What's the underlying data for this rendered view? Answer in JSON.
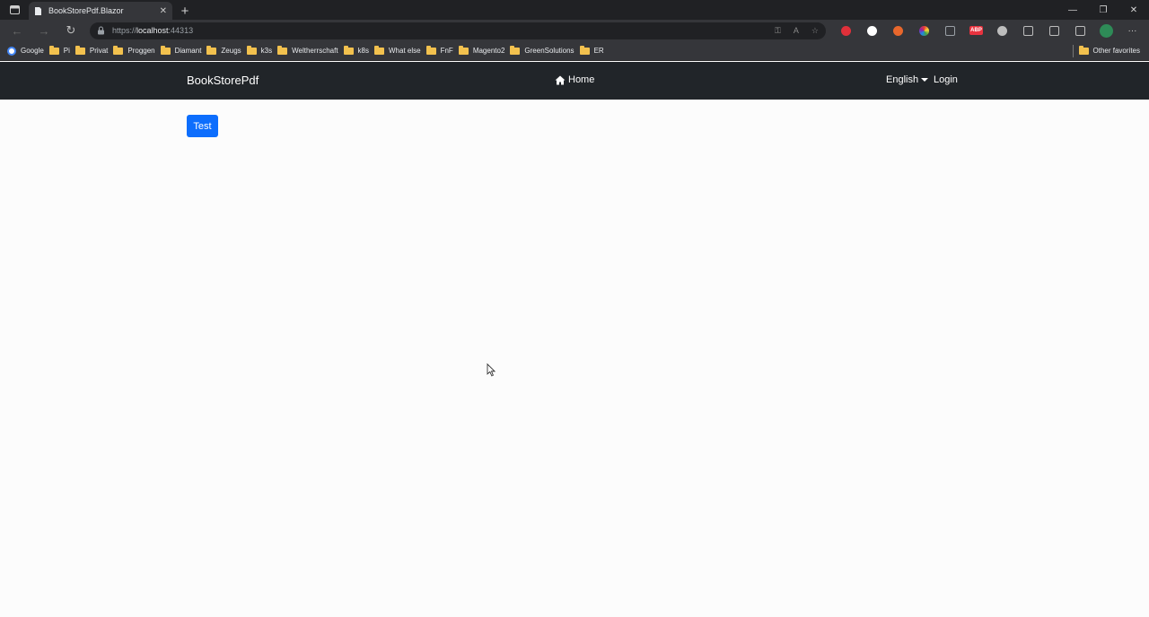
{
  "browser": {
    "tab": {
      "title": "BookStorePdf.Blazor"
    },
    "address": {
      "scheme": "https://",
      "host": "localhost",
      "port": ":44313"
    },
    "bookmarks": [
      {
        "label": "Google",
        "icon": "google-icon"
      },
      {
        "label": "Pi",
        "icon": "folder-icon"
      },
      {
        "label": "Privat",
        "icon": "folder-icon"
      },
      {
        "label": "Proggen",
        "icon": "folder-icon"
      },
      {
        "label": "Diamant",
        "icon": "folder-icon"
      },
      {
        "label": "Zeugs",
        "icon": "folder-icon"
      },
      {
        "label": "k3s",
        "icon": "folder-icon"
      },
      {
        "label": "Weltherrschaft",
        "icon": "folder-icon"
      },
      {
        "label": "k8s",
        "icon": "folder-icon"
      },
      {
        "label": "What else",
        "icon": "folder-icon"
      },
      {
        "label": "FnF",
        "icon": "folder-icon"
      },
      {
        "label": "Magento2",
        "icon": "folder-icon"
      },
      {
        "label": "GreenSolutions",
        "icon": "folder-icon"
      },
      {
        "label": "ER",
        "icon": "folder-icon"
      }
    ],
    "other_favorites": "Other favorites",
    "extensions": [
      {
        "icon": "red-shield-icon",
        "color": "#e0303a"
      },
      {
        "icon": "white-circle-icon",
        "color": "#ffffff"
      },
      {
        "icon": "fox-icon",
        "color": "#e8672c"
      },
      {
        "icon": "color-wheel-icon",
        "color": "#c04ce0"
      },
      {
        "icon": "image-icon",
        "color": "#9aa0a6"
      },
      {
        "icon": "abp-icon",
        "color": "#e8333f",
        "text": "ABP"
      },
      {
        "icon": "sync-icon",
        "color": "#bdbdbd"
      },
      {
        "icon": "puzzle-icon",
        "color": "#bdbdbd"
      },
      {
        "icon": "favorites-icon",
        "color": "#bdbdbd"
      },
      {
        "icon": "collections-icon",
        "color": "#bdbdbd"
      },
      {
        "icon": "profile-avatar-icon",
        "color": "#2e8b57"
      },
      {
        "icon": "more-icon",
        "color": "#bdbdbd",
        "text": "···"
      }
    ]
  },
  "app": {
    "brand": "BookStorePdf",
    "nav": {
      "home": "Home"
    },
    "language": "English",
    "login": "Login",
    "test_button": "Test",
    "colors": {
      "navbar": "#212529",
      "primary": "#0d6efd"
    }
  }
}
